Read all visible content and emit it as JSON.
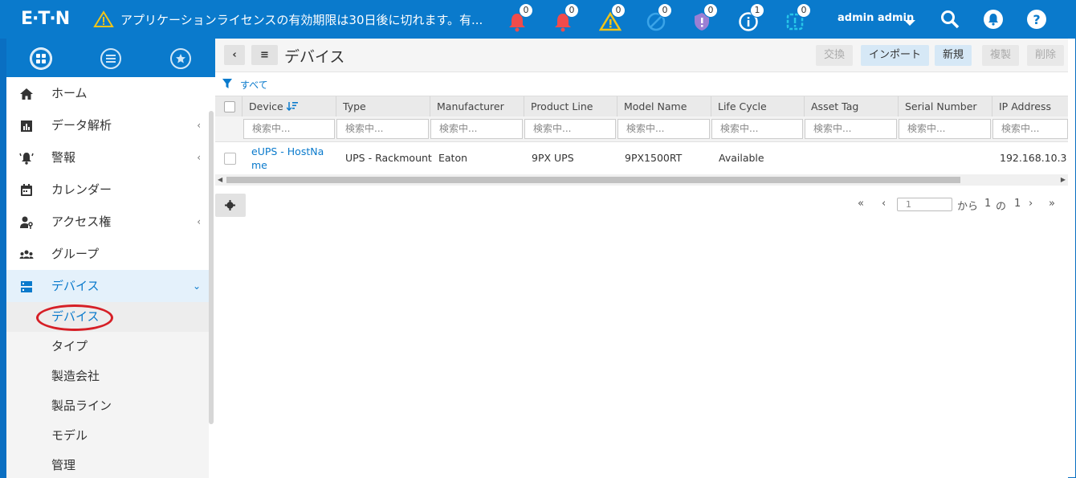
{
  "header": {
    "logo": "E·T·N",
    "license_message": "アプリケーションライセンスの有効期限は30日後に切れます。有...",
    "notifications": [
      {
        "name": "critical-alarm",
        "count": "0",
        "color": "#f04b4b"
      },
      {
        "name": "alarm",
        "count": "0",
        "color": "#f04b4b"
      },
      {
        "name": "warning",
        "count": "0",
        "color": "#f2c417"
      },
      {
        "name": "disabled",
        "count": "0",
        "color": "#3aa4e8"
      },
      {
        "name": "security",
        "count": "0",
        "color": "#9b7fd4"
      },
      {
        "name": "info",
        "count": "1",
        "color": "#ffffff"
      },
      {
        "name": "maintenance",
        "count": "0",
        "color": "#27c6e8"
      }
    ],
    "user": "admin admin"
  },
  "sidebar": {
    "items": [
      {
        "label": "ホーム",
        "icon": "home-icon"
      },
      {
        "label": "データ解析",
        "icon": "chart-icon",
        "chevron": "‹"
      },
      {
        "label": "警報",
        "icon": "bell-ring-icon",
        "chevron": "‹"
      },
      {
        "label": "カレンダー",
        "icon": "calendar-icon"
      },
      {
        "label": "アクセス権",
        "icon": "user-key-icon",
        "chevron": "‹"
      },
      {
        "label": "グループ",
        "icon": "group-icon"
      },
      {
        "label": "デバイス",
        "icon": "devices-icon",
        "chevron": "⌄"
      }
    ],
    "subitems": [
      "デバイス",
      "タイプ",
      "製造会社",
      "製品ライン",
      "モデル",
      "管理"
    ]
  },
  "toolbar": {
    "back": "‹",
    "menu": "≡",
    "title": "デバイス",
    "buttons": [
      "交換",
      "インポート",
      "新規",
      "複製",
      "削除"
    ]
  },
  "filter": {
    "label": "すべて"
  },
  "grid": {
    "columns": [
      "Device",
      "Type",
      "Manufacturer",
      "Product Line",
      "Model Name",
      "Life Cycle",
      "Asset Tag",
      "Serial Number",
      "IP Address"
    ],
    "search_placeholder": "検索中...",
    "rows": [
      {
        "device": "eUPS - HostName",
        "type": "UPS - Rackmount",
        "manufacturer": "Eaton",
        "product_line": "9PX UPS",
        "model": "9PX1500RT",
        "life_cycle": "Available",
        "asset_tag": "",
        "serial": "",
        "ip": "192.168.10.3"
      }
    ]
  },
  "pager": {
    "first": "«",
    "prev": "‹",
    "page": "1",
    "from": "から",
    "current": "1",
    "of": "の",
    "total": "1",
    "next": "›",
    "last": "»"
  }
}
